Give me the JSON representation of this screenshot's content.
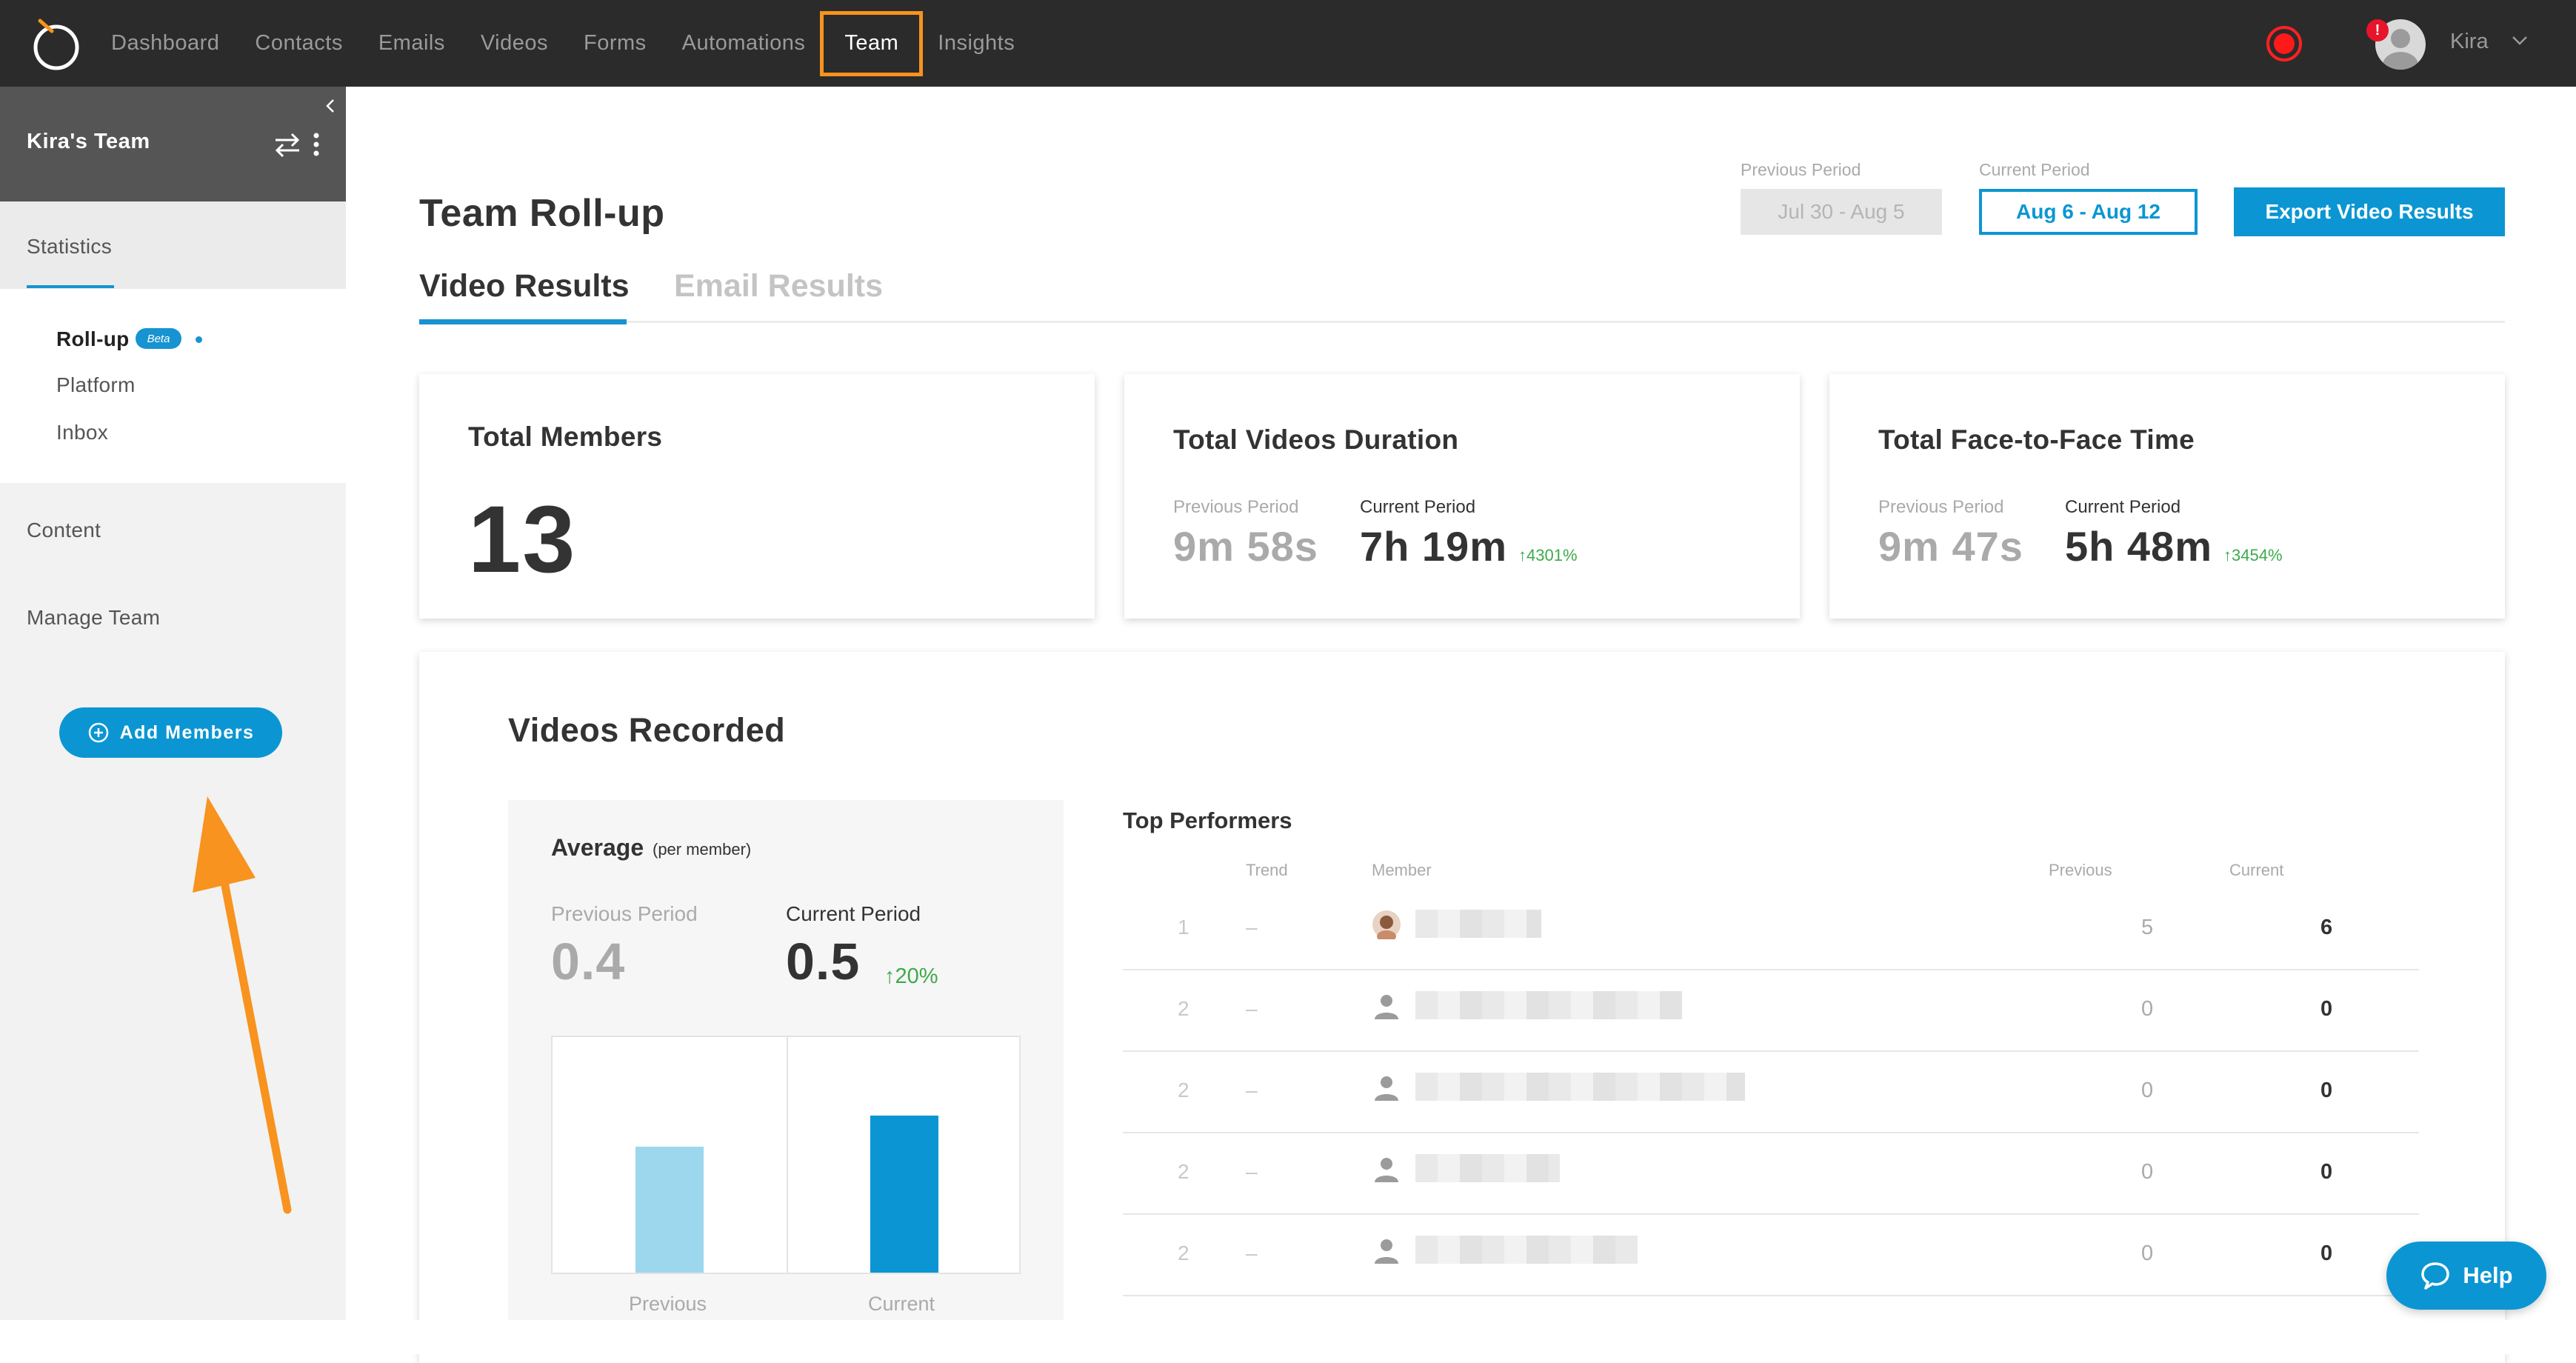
{
  "nav": {
    "items": [
      {
        "label": "Dashboard"
      },
      {
        "label": "Contacts"
      },
      {
        "label": "Emails"
      },
      {
        "label": "Videos"
      },
      {
        "label": "Forms"
      },
      {
        "label": "Automations"
      },
      {
        "label": "Team",
        "active": true
      },
      {
        "label": "Insights"
      }
    ],
    "user_name": "Kira",
    "alert_badge": "!",
    "highlight_color": "#f7931e",
    "record_color": "#ff1a1a"
  },
  "sidebar": {
    "team_name": "Kira's Team",
    "statistics_label": "Statistics",
    "statistics_items": [
      {
        "label": "Roll-up",
        "active": true,
        "badge": "Beta"
      },
      {
        "label": "Platform"
      },
      {
        "label": "Inbox"
      }
    ],
    "content_label": "Content",
    "manage_team_label": "Manage Team",
    "add_members_label": "Add Members"
  },
  "header": {
    "title": "Team Roll-up",
    "previous_period_label": "Previous Period",
    "previous_period_value": "Jul 30 - Aug 5",
    "current_period_label": "Current Period",
    "current_period_value": "Aug 6 - Aug 12",
    "export_label": "Export Video Results"
  },
  "tabs": [
    {
      "label": "Video Results",
      "active": true
    },
    {
      "label": "Email Results",
      "active": false
    }
  ],
  "cards": {
    "total_members": {
      "title": "Total Members",
      "value": "13"
    },
    "total_duration": {
      "title": "Total Videos Duration",
      "prev_label": "Previous Period",
      "prev_value": "9m 58s",
      "cur_label": "Current Period",
      "cur_value": "7h 19m",
      "change": "↑4301%"
    },
    "face_time": {
      "title": "Total Face-to-Face Time",
      "prev_label": "Previous Period",
      "prev_value": "9m 47s",
      "cur_label": "Current Period",
      "cur_value": "5h 48m",
      "change": "↑3454%"
    }
  },
  "videos_recorded": {
    "title": "Videos Recorded",
    "average": {
      "title": "Average",
      "subtitle": "(per member)",
      "prev_label": "Previous Period",
      "prev_value": "0.4",
      "cur_label": "Current Period",
      "cur_value": "0.5",
      "change": "↑20%",
      "bar_labels": [
        "Previous",
        "Current"
      ]
    },
    "top_performers": {
      "title": "Top Performers",
      "columns": [
        "Trend",
        "Member",
        "Previous",
        "Current"
      ],
      "rows": [
        {
          "rank": "1",
          "trend": "–",
          "avatar": "photo",
          "name": "██████",
          "previous": "5",
          "current": "6"
        },
        {
          "rank": "2",
          "trend": "–",
          "avatar": "person-icon",
          "name": "████████████",
          "previous": "0",
          "current": "0"
        },
        {
          "rank": "2",
          "trend": "–",
          "avatar": "person-icon",
          "name": "███████████████",
          "previous": "0",
          "current": "0"
        },
        {
          "rank": "2",
          "trend": "–",
          "avatar": "person-icon",
          "name": "██████",
          "previous": "0",
          "current": "0"
        },
        {
          "rank": "2",
          "trend": "–",
          "avatar": "person-icon",
          "name": "██████████",
          "previous": "0",
          "current": "0"
        }
      ]
    }
  },
  "chart_data": {
    "type": "bar",
    "categories": [
      "Previous",
      "Current"
    ],
    "values": [
      0.4,
      0.5
    ],
    "title": "",
    "xlabel": "",
    "ylabel": "",
    "ylim": [
      0,
      0.75
    ],
    "grid": false
  },
  "help_label": "Help"
}
